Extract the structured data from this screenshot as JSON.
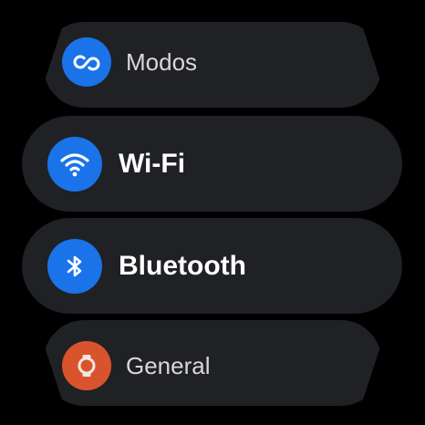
{
  "settings_list": {
    "items": [
      {
        "id": "modos",
        "label": "Modos",
        "icon": "modes-icon",
        "icon_bg": "#1a73e8"
      },
      {
        "id": "wifi",
        "label": "Wi-Fi",
        "icon": "wifi-icon",
        "icon_bg": "#1a73e8"
      },
      {
        "id": "bluetooth",
        "label": "Bluetooth",
        "icon": "bluetooth-icon",
        "icon_bg": "#1a73e8"
      },
      {
        "id": "general",
        "label": "General",
        "icon": "watch-icon",
        "icon_bg": "#d9542c"
      }
    ]
  },
  "colors": {
    "background": "#000000",
    "chip": "#202124",
    "label": "#ffffff"
  }
}
